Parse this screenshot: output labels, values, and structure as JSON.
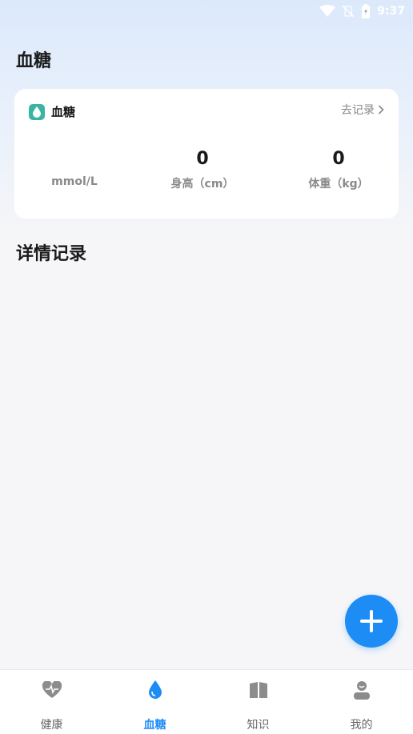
{
  "status_bar": {
    "time": "9:37"
  },
  "page": {
    "title": "血糖"
  },
  "card": {
    "title": "血糖",
    "link_label": "去记录",
    "metrics": [
      {
        "value": "",
        "label": "mmol/L"
      },
      {
        "value": "0",
        "label": "身高（cm）"
      },
      {
        "value": "0",
        "label": "体重（kg）"
      }
    ]
  },
  "section": {
    "title": "详情记录"
  },
  "tabs": [
    {
      "label": "健康",
      "icon": "heart-icon",
      "active": false
    },
    {
      "label": "血糖",
      "icon": "drop-icon",
      "active": true
    },
    {
      "label": "知识",
      "icon": "book-icon",
      "active": false
    },
    {
      "label": "我的",
      "icon": "user-icon",
      "active": false
    }
  ],
  "colors": {
    "accent": "#1d8df5",
    "card_icon": "#3ab4a2",
    "inactive_icon": "#8c8c8c"
  }
}
